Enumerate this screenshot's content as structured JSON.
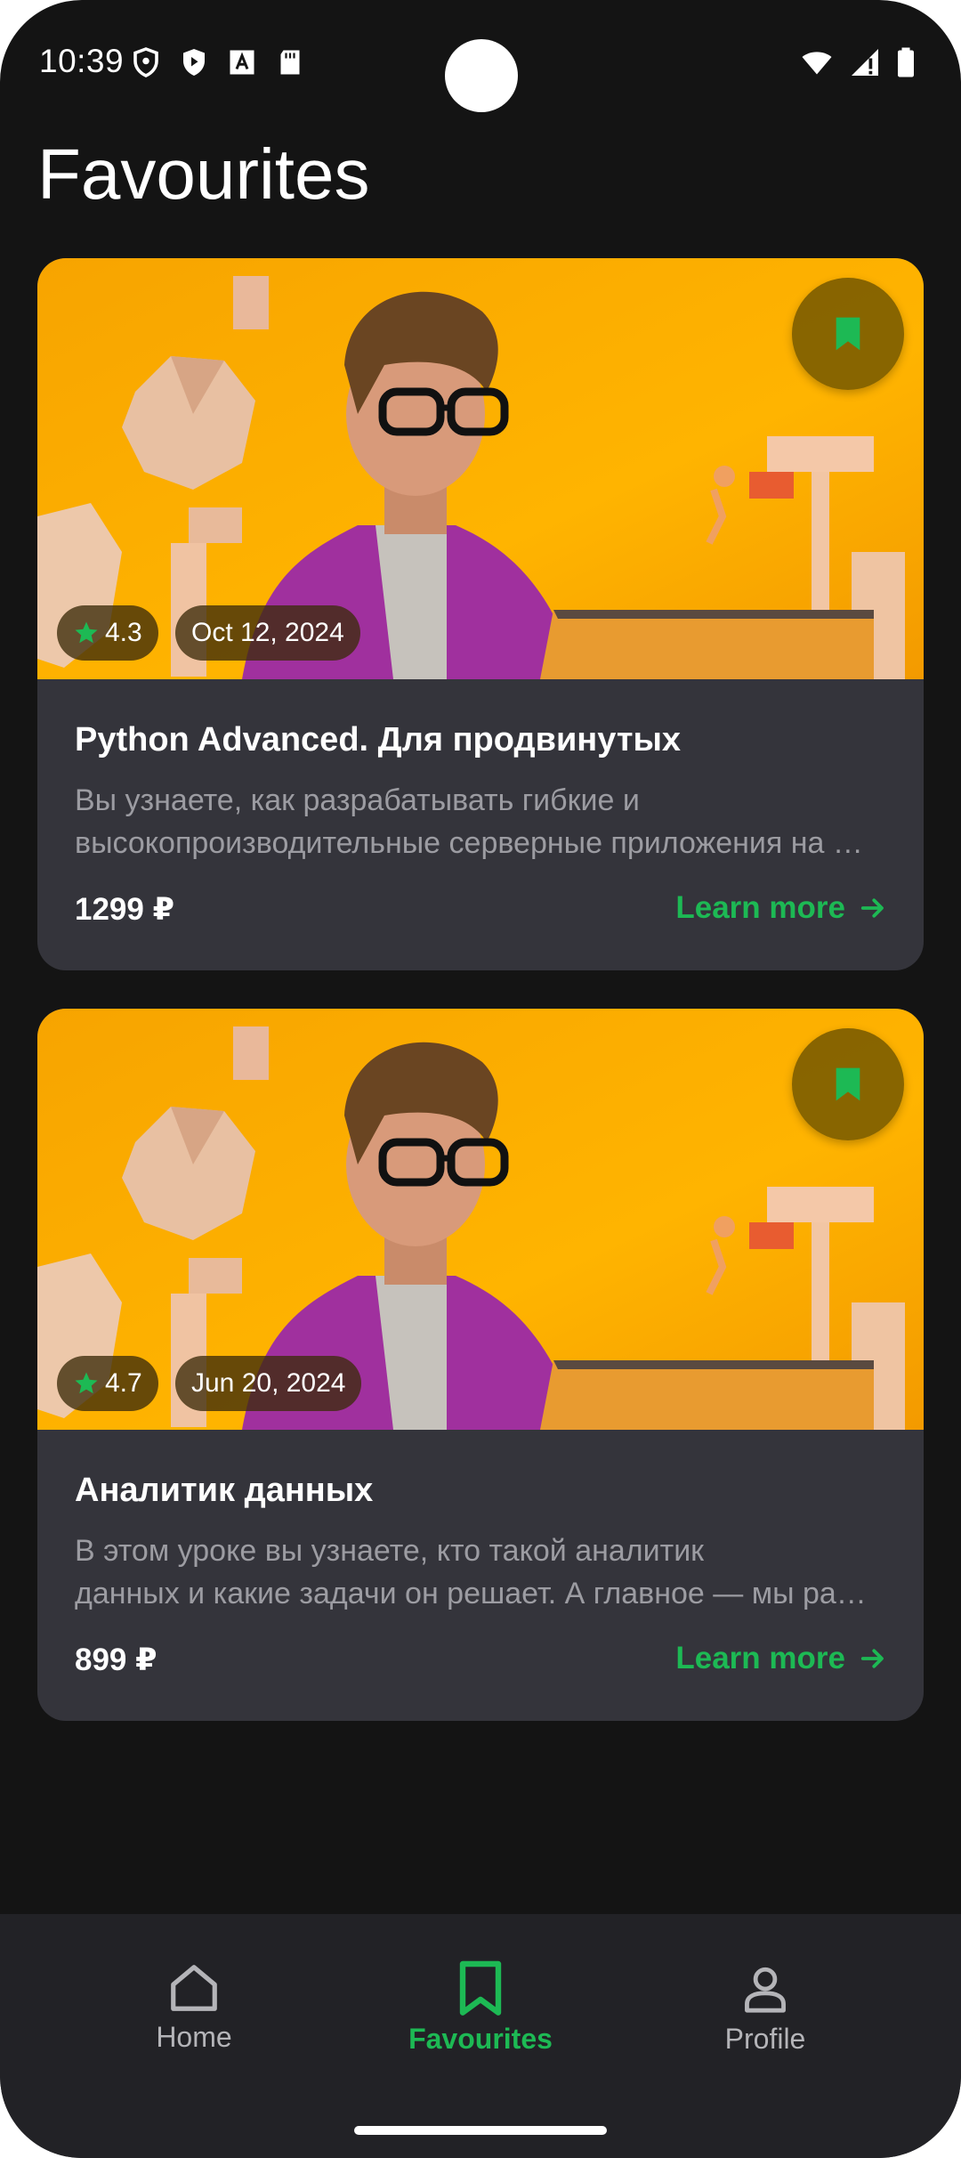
{
  "status_bar": {
    "time": "10:39",
    "left_icons": [
      "shield-icon",
      "play-protect-icon",
      "font-icon",
      "sd-card-icon"
    ],
    "right_icons": [
      "wifi-icon",
      "signal-icon",
      "battery-icon"
    ]
  },
  "page": {
    "title": "Favourites"
  },
  "colors": {
    "accent": "#1db954",
    "card_bg": "#34343b",
    "background": "#141414"
  },
  "courses": [
    {
      "rating": "4.3",
      "date": "Oct 12, 2024",
      "title": "Python Advanced. Для продвинутых",
      "description_line1": "Вы узнаете, как разрабатывать гибкие и",
      "description_line2": "высокопроизводительные серверные приложения на Python",
      "price": "1299 ₽",
      "cta": "Learn more",
      "bookmarked": true
    },
    {
      "rating": "4.7",
      "date": "Jun 20, 2024",
      "title": "Аналитик данных",
      "description_line1": "В этом уроке вы узнаете, кто такой аналитик",
      "description_line2": "данных и какие задачи он решает. А главное — мы расскажем",
      "price": "899 ₽",
      "cta": "Learn more",
      "bookmarked": true
    }
  ],
  "bottom_nav": {
    "items": [
      {
        "label": "Home",
        "icon": "home-icon",
        "active": false
      },
      {
        "label": "Favourites",
        "icon": "bookmark-icon",
        "active": true
      },
      {
        "label": "Profile",
        "icon": "person-icon",
        "active": false
      }
    ]
  }
}
